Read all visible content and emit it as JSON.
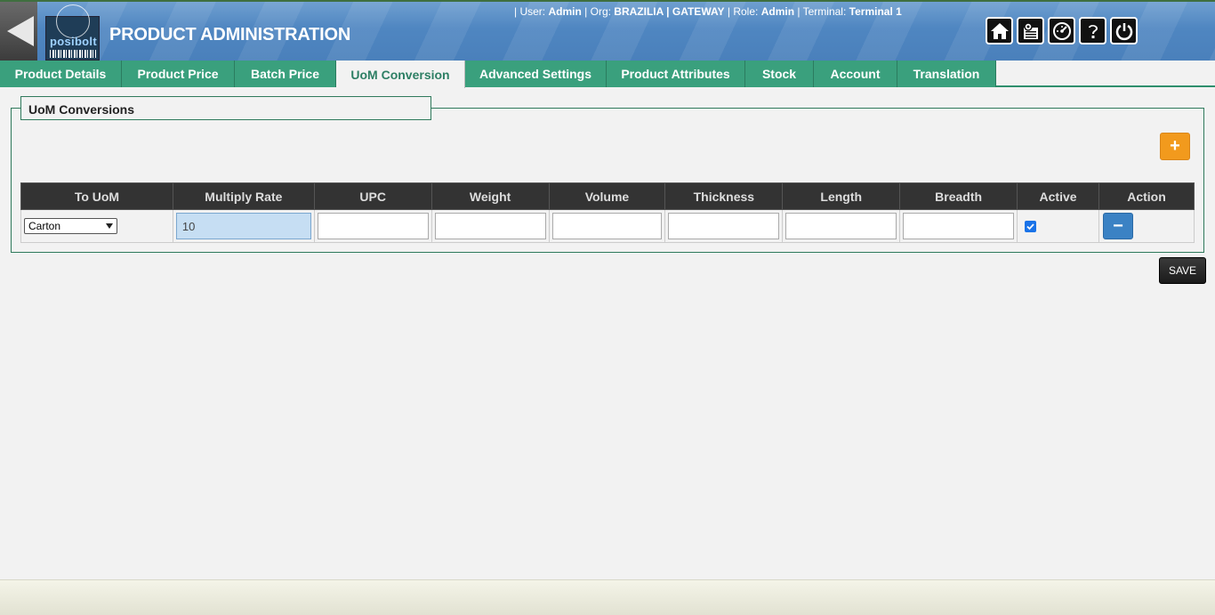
{
  "header": {
    "title": "PRODUCT ADMINISTRATION",
    "brand": "posibolt",
    "user_label": "| User:",
    "user_value": "Admin",
    "org_label": "| Org:",
    "org_value": "BRAZILIA | GATEWAY",
    "role_label": "| Role:",
    "role_value": "Admin",
    "terminal_label": "| Terminal:",
    "terminal_value": "Terminal 1",
    "icons": [
      "home-icon",
      "settings-icon",
      "dashboard-icon",
      "help-icon",
      "power-icon"
    ]
  },
  "tabs": [
    {
      "label": "Product Details"
    },
    {
      "label": "Product Price"
    },
    {
      "label": "Batch Price"
    },
    {
      "label": "UoM Conversion",
      "active": true
    },
    {
      "label": "Advanced Settings"
    },
    {
      "label": "Product Attributes"
    },
    {
      "label": "Stock"
    },
    {
      "label": "Account"
    },
    {
      "label": "Translation"
    }
  ],
  "section": {
    "legend": "UoM Conversions",
    "add_label": "+"
  },
  "table": {
    "headers": [
      "To UoM",
      "Multiply Rate",
      "UPC",
      "Weight",
      "Volume",
      "Thickness",
      "Length",
      "Breadth",
      "Active",
      "Action"
    ],
    "rows": [
      {
        "to_uom": "Carton",
        "multiply_rate": "10",
        "upc": "",
        "weight": "",
        "volume": "",
        "thickness": "",
        "length": "",
        "breadth": "",
        "active": true,
        "action_label": "−"
      }
    ]
  },
  "save_label": "SAVE",
  "colors": {
    "accent": "#3aa07d",
    "add": "#f29a1d",
    "delete": "#3b82c4"
  }
}
